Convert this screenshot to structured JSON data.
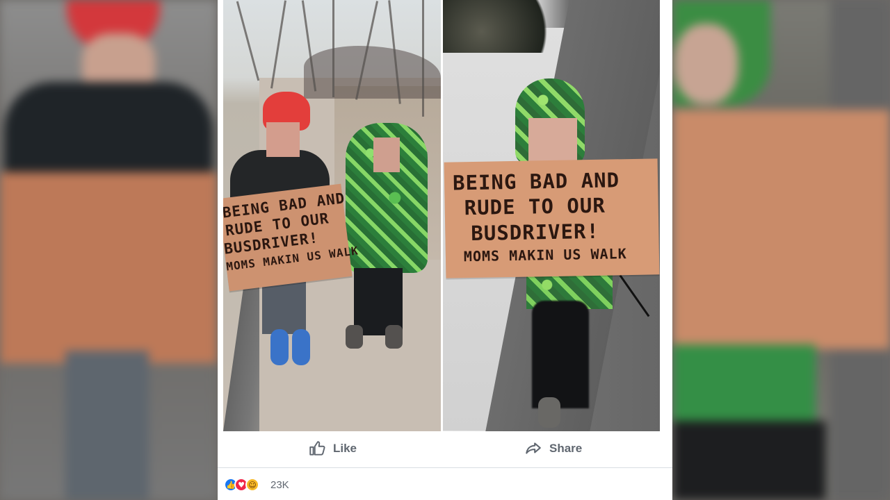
{
  "post": {
    "left_sign_text": [
      "BEING BAD AND",
      "RUDE TO OUR",
      "BUSDRIVER!",
      "MOMS MAKIN US WALK"
    ],
    "right_sign_text": [
      "BEING BAD AND",
      "RUDE TO OUR",
      "BUSDRIVER!",
      "MOMS MAKIN US WALK"
    ],
    "actions": {
      "like_label": "Like",
      "share_label": "Share"
    },
    "reactions": {
      "icons": [
        "like-reaction-icon",
        "love-reaction-icon",
        "haha-reaction-icon"
      ],
      "count": "23K"
    }
  },
  "colors": {
    "card_background": "#ffffff",
    "action_text": "#606770",
    "facebook_blue": "#1877f2",
    "love_red": "#f02849",
    "haha_yellow": "#f7b928",
    "sign_cardboard": "#d79b76"
  }
}
